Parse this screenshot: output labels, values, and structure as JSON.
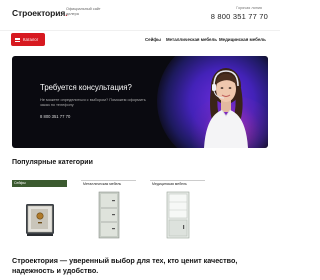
{
  "header": {
    "logo_text": "Строектория",
    "logo_dot": ".",
    "tagline": "Официальный сайт дилера",
    "call_label": "Горячая линия",
    "phone": "8 800 351 77 70"
  },
  "nav": {
    "catalog_label": "Каталог",
    "links": [
      "Сейфы",
      "Металлическая мебель",
      "Медицинская мебель"
    ]
  },
  "banner": {
    "title": "Требуется консультация?",
    "text": "Не можете определиться с выбором? Поможем оформить заказ по телефону",
    "phone": "8 800 351 77 70"
  },
  "popular": {
    "title": "Популярные категории",
    "categories": [
      {
        "label": "Сейфы",
        "icon": "safe-icon"
      },
      {
        "label": "Металлическая мебель",
        "icon": "metal-cabinet-icon"
      },
      {
        "label": "Медицинская мебель",
        "icon": "medical-cabinet-icon"
      }
    ]
  },
  "bottom": {
    "title": "Строектория — уверенный выбор для тех, кто ценит качество, надежность и удобство."
  },
  "colors": {
    "accent": "#d71920",
    "banner_bg": "#0a0a10",
    "active_tab": "#3b5a2f"
  }
}
